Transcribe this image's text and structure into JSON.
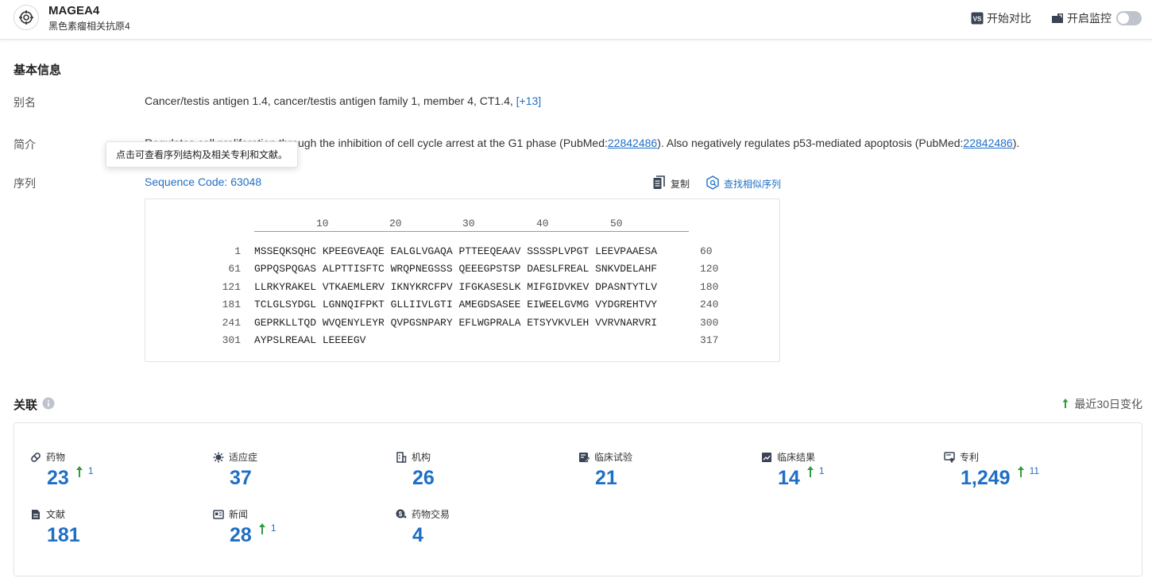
{
  "header": {
    "title": "MAGEA4",
    "subtitle": "黑色素瘤相关抗原4",
    "compare_label": "开始对比",
    "compare_badge": "VS",
    "monitor_label": "开启监控"
  },
  "basic": {
    "section_title": "基本信息",
    "alias_label": "别名",
    "aliases": "Cancer/testis antigen 1.4,  cancer/testis antigen family 1, member 4,  CT1.4,",
    "aliases_more": "[+13]",
    "summary_label": "简介",
    "summary_pre": "Regulates cell proliferation through the inhibition of cell cycle arrest at the G1 phase (PubMed:",
    "summary_pm1": "22842486",
    "summary_mid": "). Also negatively regulates p53-mediated apoptosis (PubMed:",
    "summary_pm2": "22842486",
    "summary_post": ").",
    "tooltip": "点击可查看序列结构及相关专利和文献。",
    "sequence_label": "序列",
    "sequence_code": "Sequence Code: 63048",
    "copy_label": "复制",
    "find_similar_label": "查找相似序列"
  },
  "sequence": {
    "ruler": [
      "10",
      "20",
      "30",
      "40",
      "50"
    ],
    "rows": [
      {
        "start": "1",
        "residues": "MSSEQKSQHC KPEEGVEAQE EALGLVGAQA PTTEEQEAAV SSSSPLVPGT LEEVPAAESA",
        "end": "60"
      },
      {
        "start": "61",
        "residues": "GPPQSPQGAS ALPTTISFTC WRQPNEGSSS QEEEGPSTSP DAESLFREAL SNKVDELAHF",
        "end": "120"
      },
      {
        "start": "121",
        "residues": "LLRKYRAKEL VTKAEMLERV IKNYKRCFPV IFGKASESLK MIFGIDVKEV DPASNTYTLV",
        "end": "180"
      },
      {
        "start": "181",
        "residues": "TCLGLSYDGL LGNNQIFPKT GLLIIVLGTI AMEGDSASEE EIWEELGVMG VYDGREHTVY",
        "end": "240"
      },
      {
        "start": "241",
        "residues": "GEPRKLLTQD WVQENYLEYR QVPGSNPARY EFLWGPRALA ETSYVKVLEH VVRVNARVRI",
        "end": "300"
      },
      {
        "start": "301",
        "residues": "AYPSLREAAL LEEEEGV",
        "end": "317"
      }
    ]
  },
  "relations": {
    "section_title": "关联",
    "change_label": "最近30日变化",
    "stats": [
      {
        "id": "drugs",
        "label": "药物",
        "icon": "pill-icon",
        "value": "23",
        "delta": "1"
      },
      {
        "id": "indications",
        "label": "适应症",
        "icon": "virus-icon",
        "value": "37",
        "delta": null
      },
      {
        "id": "organizations",
        "label": "机构",
        "icon": "building-icon",
        "value": "26",
        "delta": null
      },
      {
        "id": "clinical-trials",
        "label": "临床试验",
        "icon": "clipboard-edit-icon",
        "value": "21",
        "delta": null
      },
      {
        "id": "clinical-results",
        "label": "临床结果",
        "icon": "chart-doc-icon",
        "value": "14",
        "delta": "1"
      },
      {
        "id": "patents",
        "label": "专利",
        "icon": "certificate-icon",
        "value": "1,249",
        "delta": "11"
      },
      {
        "id": "literature",
        "label": "文献",
        "icon": "document-icon",
        "value": "181",
        "delta": null
      },
      {
        "id": "news",
        "label": "新闻",
        "icon": "newspaper-icon",
        "value": "28",
        "delta": "1"
      },
      {
        "id": "deals",
        "label": "药物交易",
        "icon": "dollar-exchange-icon",
        "value": "4",
        "delta": null
      }
    ]
  },
  "colors": {
    "accent": "#1f6fc5",
    "increase": "#2e9d3a",
    "toggle_off": "#bfc4cc"
  }
}
